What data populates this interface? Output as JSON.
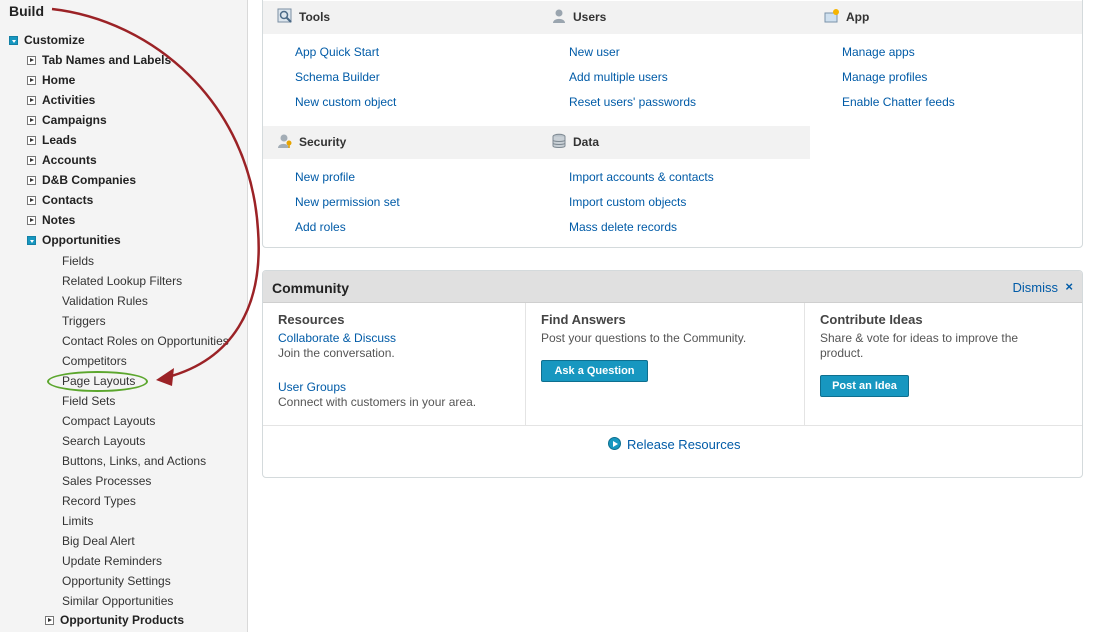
{
  "sidebar": {
    "title": "Build",
    "customize": {
      "label": "Customize",
      "items": [
        "Tab Names and Labels",
        "Home",
        "Activities",
        "Campaigns",
        "Leads",
        "Accounts",
        "D&B Companies",
        "Contacts",
        "Notes"
      ],
      "opportunities": {
        "label": "Opportunities",
        "children": [
          "Fields",
          "Related Lookup Filters",
          "Validation Rules",
          "Triggers",
          "Contact Roles on Opportunities",
          "Competitors",
          "Page Layouts",
          "Field Sets",
          "Compact Layouts",
          "Search Layouts",
          "Buttons, Links, and Actions",
          "Sales Processes",
          "Record Types",
          "Limits",
          "Big Deal Alert",
          "Update Reminders",
          "Opportunity Settings",
          "Similar Opportunities"
        ]
      },
      "opportunity_products": "Opportunity Products"
    }
  },
  "annotation": {
    "highlighted_item": "Page Layouts",
    "arrow_color": "#9b2226",
    "ellipse_color": "#5ba62d"
  },
  "setup": {
    "tools": {
      "title": "Tools",
      "links": [
        "App Quick Start",
        "Schema Builder",
        "New custom object"
      ]
    },
    "users": {
      "title": "Users",
      "links": [
        "New user",
        "Add multiple users",
        "Reset users' passwords"
      ]
    },
    "app": {
      "title": "App",
      "links": [
        "Manage apps",
        "Manage profiles",
        "Enable Chatter feeds"
      ]
    },
    "security": {
      "title": "Security",
      "links": [
        "New profile",
        "New permission set",
        "Add roles"
      ]
    },
    "data": {
      "title": "Data",
      "links": [
        "Import accounts & contacts",
        "Import custom objects",
        "Mass delete records"
      ]
    }
  },
  "community": {
    "title": "Community",
    "dismiss": "Dismiss",
    "dismiss_x": "×",
    "resources": {
      "title": "Resources",
      "link1": "Collaborate & Discuss",
      "text1": "Join the conversation.",
      "link2": "User Groups",
      "text2": "Connect with customers in your area."
    },
    "find_answers": {
      "title": "Find Answers",
      "text": "Post your questions to the Community.",
      "button": "Ask a Question"
    },
    "contribute": {
      "title": "Contribute Ideas",
      "text": "Share & vote for ideas to improve the product.",
      "button": "Post an Idea"
    },
    "release": "Release Resources"
  },
  "colors": {
    "link": "#015ba7",
    "button": "#1797c0",
    "accent_arrow": "#9b2226"
  }
}
